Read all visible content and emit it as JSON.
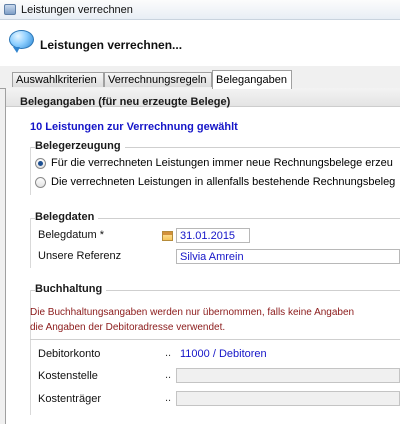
{
  "window": {
    "title": "Leistungen verrechnen"
  },
  "header": {
    "heading": "Leistungen verrechnen..."
  },
  "tabs": [
    {
      "label": "Auswahlkriterien"
    },
    {
      "label": "Verrechnungsregeln"
    },
    {
      "label": "Belegangaben"
    }
  ],
  "panel": {
    "title": "Belegangaben (für neu erzeugte Belege)",
    "info": "10 Leistungen zur Verrechnung gewählt"
  },
  "belegerzeugung": {
    "title": "Belegerzeugung",
    "options": [
      {
        "label": "Für die verrechneten Leistungen immer neue Rechnungsbelege erzeu",
        "checked": true
      },
      {
        "label": "Die verrechneten Leistungen in allenfalls bestehende Rechnungsbeleg",
        "checked": false
      }
    ]
  },
  "belegdaten": {
    "title": "Belegdaten",
    "datum_label": "Belegdatum *",
    "datum_value": "31.01.2015",
    "referenz_label": "Unsere Referenz",
    "referenz_value": "Silvia Amrein"
  },
  "buchhaltung": {
    "title": "Buchhaltung",
    "note_line1": "Die Buchhaltungsangaben werden nur übernommen, falls keine Angaben",
    "note_line2": "die Angaben der Debitoradresse verwendet.",
    "debitor_label": "Debitorkonto",
    "debitor_value": "11000 / Debitoren",
    "kostenstelle_label": "Kostenstelle",
    "kostenstelle_value": "",
    "kostentraeger_label": "Kostenträger",
    "kostentraeger_value": "",
    "dots": ".."
  }
}
